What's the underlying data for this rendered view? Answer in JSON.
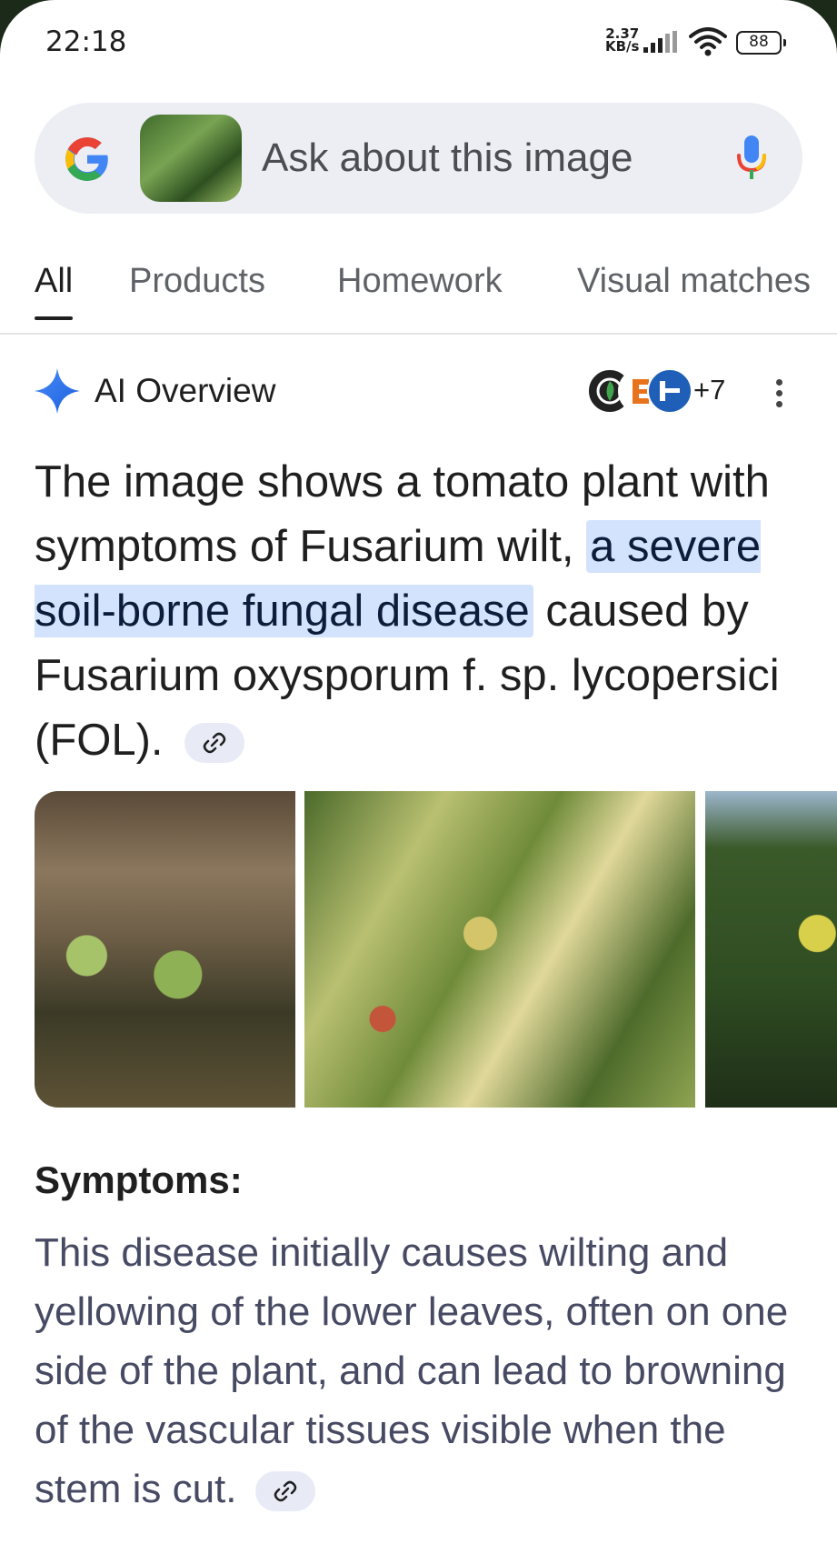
{
  "status_bar": {
    "time": "22:18",
    "net_speed_value": "2.37",
    "net_speed_unit": "KB/s",
    "battery": "88"
  },
  "search": {
    "placeholder": "Ask about this image",
    "icons": [
      "google-g-icon",
      "image-thumbnail",
      "mic-icon"
    ]
  },
  "tabs": [
    {
      "label": "All",
      "active": true
    },
    {
      "label": "Products",
      "active": false
    },
    {
      "label": "Homework",
      "active": false
    },
    {
      "label": "Visual matches",
      "active": false
    }
  ],
  "ai_overview": {
    "title": "AI Overview",
    "more_sources": "+7",
    "text_before": "The image shows a tomato plant with symptoms of Fusarium wilt, ",
    "text_highlight": "a severe soil-borne fungal disease",
    "text_after": " caused by Fusarium oxysporum f. sp. lycopersici (FOL)."
  },
  "symptoms": {
    "title": "Symptoms:",
    "text": "This disease initially causes wilting and yellowing of the lower leaves, often on one side of the plant, and can lead to browning of the vascular tissues visible when the stem is cut."
  },
  "colors": {
    "highlight": "#d3e3fd",
    "accent_blue": "#1a73e8",
    "text": "#1f1f1f",
    "secondary_text": "#474a63"
  }
}
